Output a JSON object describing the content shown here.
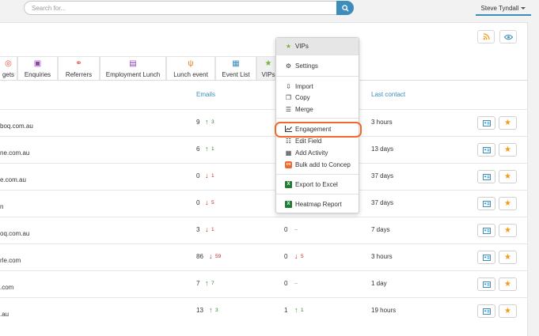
{
  "search": {
    "placeholder": "Search for..."
  },
  "user": {
    "name": "Steve Tyndall"
  },
  "tabs": [
    {
      "label": "gets",
      "icon": "target-icon"
    },
    {
      "label": "Enquiries",
      "icon": "enquiry-icon"
    },
    {
      "label": "Referrers",
      "icon": "handshake-icon"
    },
    {
      "label": "Employment Lunch",
      "icon": "briefcase-icon"
    },
    {
      "label": "Lunch event",
      "icon": "fork-knife-icon"
    },
    {
      "label": "Event List",
      "icon": "calendar-icon"
    },
    {
      "label": "VIPs",
      "icon": "star-icon"
    }
  ],
  "columns": {
    "emails": "Emails",
    "last_contact": "Last contact"
  },
  "rows": [
    {
      "name": "boq.com.au",
      "emails": "9",
      "emails_delta": "3",
      "emails_dir": "up",
      "col2": "",
      "col2_delta": "",
      "col2_dir": "",
      "last": "3 hours"
    },
    {
      "name": "ne.com.au",
      "emails": "6",
      "emails_delta": "1",
      "emails_dir": "up",
      "col2": "",
      "col2_delta": "",
      "col2_dir": "",
      "last": "13 days"
    },
    {
      "name": "e.com.au",
      "emails": "0",
      "emails_delta": "1",
      "emails_dir": "down",
      "col2": "",
      "col2_delta": "",
      "col2_dir": "",
      "last": "37 days"
    },
    {
      "name": "n",
      "emails": "0",
      "emails_delta": "5",
      "emails_dir": "down",
      "col2": "",
      "col2_delta": "",
      "col2_dir": "",
      "last": "37 days"
    },
    {
      "name": "oq.com.au",
      "emails": "3",
      "emails_delta": "1",
      "emails_dir": "down",
      "col2": "0",
      "col2_delta": "--",
      "col2_dir": "none",
      "last": "7 days"
    },
    {
      "name": "rle.com",
      "emails": "86",
      "emails_delta": "59",
      "emails_dir": "down",
      "col2": "0",
      "col2_delta": "5",
      "col2_dir": "down",
      "last": "3 hours"
    },
    {
      "name": ".com",
      "emails": "7",
      "emails_delta": "7",
      "emails_dir": "up",
      "col2": "0",
      "col2_delta": "--",
      "col2_dir": "none",
      "last": "1 day"
    },
    {
      "name": ".au",
      "emails": "13",
      "emails_delta": "3",
      "emails_dir": "up",
      "col2": "1",
      "col2_delta": "1",
      "col2_dir": "up",
      "last": "19 hours"
    }
  ],
  "menu": {
    "header": "VIPs",
    "items": [
      {
        "label": "Settings",
        "icon": "gear-icon"
      },
      {
        "label": "Import",
        "icon": "import-icon"
      },
      {
        "label": "Copy",
        "icon": "copy-icon"
      },
      {
        "label": "Merge",
        "icon": "merge-icon"
      },
      {
        "label": "Engagement",
        "icon": "chart-icon"
      },
      {
        "label": "Edit Field",
        "icon": "list-icon"
      },
      {
        "label": "Add Activity",
        "icon": "calendar-icon"
      },
      {
        "label": "Bulk add to Concep",
        "icon": "concep-icon"
      },
      {
        "label": "Export to Excel",
        "icon": "excel-icon"
      },
      {
        "label": "Heatmap Report",
        "icon": "excel-icon"
      }
    ]
  },
  "colors": {
    "accent": "#3c8dbc",
    "highlight": "#f2672e",
    "star": "#f39c12",
    "up": "#2e7d32",
    "down": "#c62828"
  }
}
